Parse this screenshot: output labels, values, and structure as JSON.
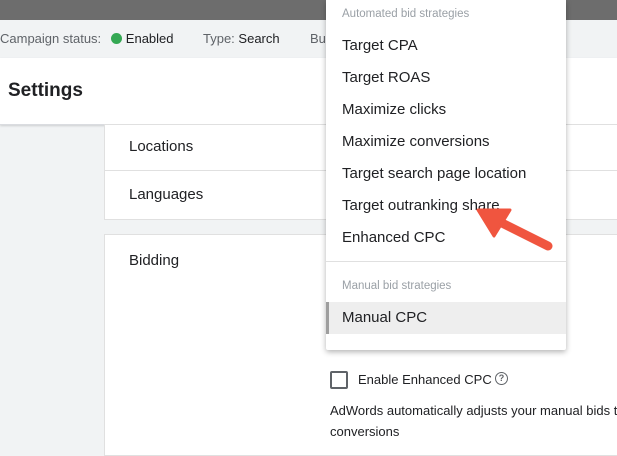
{
  "status_bar": {
    "campaign_status_label": "Campaign status:",
    "campaign_status_value": "Enabled",
    "type_label": "Type:",
    "type_value": "Search",
    "budget_label": "Bu"
  },
  "page": {
    "title": "Settings"
  },
  "sections": {
    "locations": "Locations",
    "languages": "Languages",
    "bidding": "Bidding"
  },
  "bidding": {
    "enhanced_cpc_checkbox_label": "Enable Enhanced CPC",
    "enhanced_cpc_checked": false,
    "description_line1": "AdWords automatically adjusts your manual bids t",
    "description_line2": "conversions"
  },
  "dropdown": {
    "automated_group_label": "Automated bid strategies",
    "automated_items": [
      "Target CPA",
      "Target ROAS",
      "Maximize clicks",
      "Maximize conversions",
      "Target search page location",
      "Target outranking share",
      "Enhanced CPC"
    ],
    "manual_group_label": "Manual bid strategies",
    "manual_items": [
      "Manual CPC"
    ],
    "selected": "Manual CPC"
  },
  "colors": {
    "status_enabled": "#34a853",
    "annotation_arrow": "#f0553f"
  }
}
